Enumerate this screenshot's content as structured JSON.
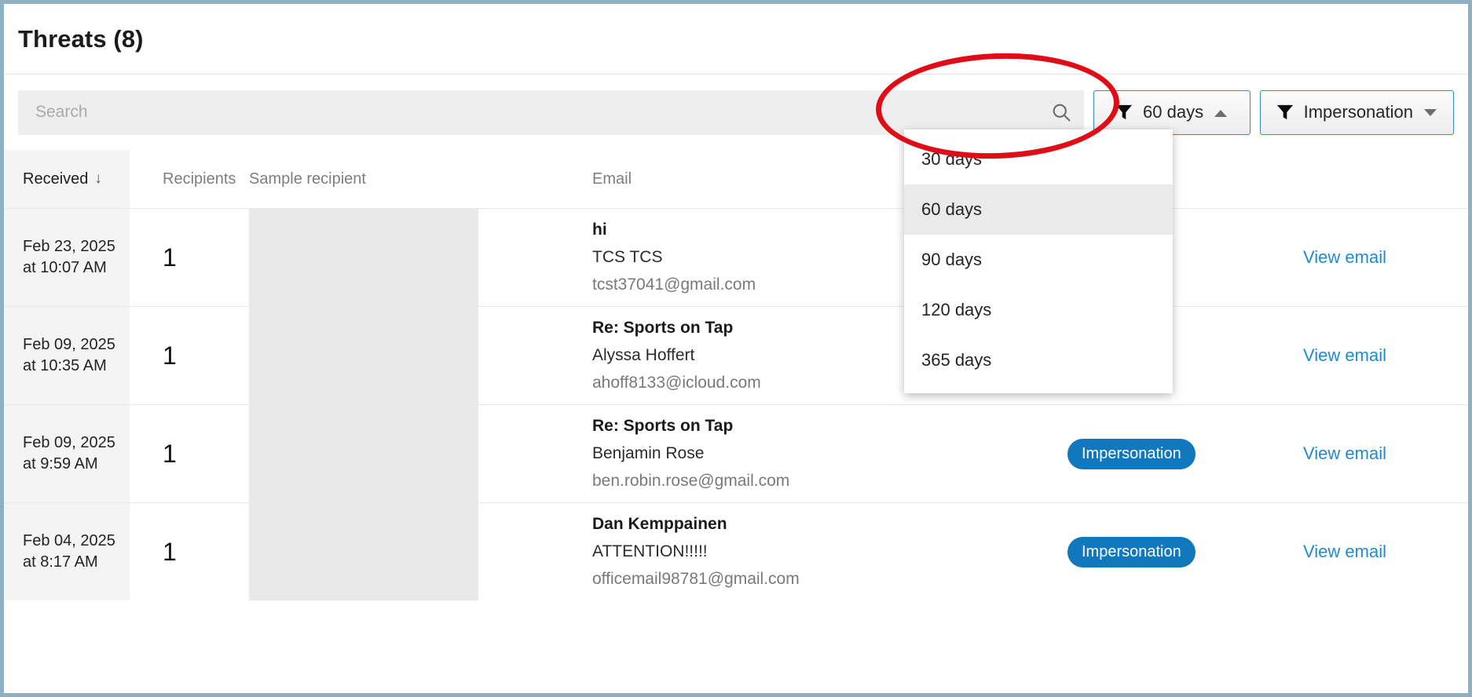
{
  "header": {
    "title": "Threats (8)"
  },
  "search": {
    "placeholder": "Search",
    "value": "",
    "icon": "search-icon"
  },
  "filters": {
    "date_range": {
      "label": "60 days",
      "icon": "funnel-icon",
      "caret": "chevron-up-icon",
      "expanded": true,
      "options": [
        "30 days",
        "60 days",
        "90 days",
        "120 days",
        "365 days"
      ],
      "selected": "60 days"
    },
    "threat_type": {
      "label": "Impersonation",
      "icon": "funnel-icon",
      "caret": "chevron-down-icon",
      "expanded": false
    }
  },
  "table": {
    "columns": {
      "received": "Received",
      "sort_indicator": "↓",
      "recipients": "Recipients",
      "sample_recipient": "Sample recipient",
      "email": "Email"
    },
    "rows": [
      {
        "received_date": "Feb 23, 2025",
        "received_time": "at 10:07 AM",
        "recipients": "1",
        "sample_recipient": "",
        "subject": "hi",
        "sender": "TCS TCS",
        "address": "tcst37041@gmail.com",
        "badge": "",
        "action": "View email"
      },
      {
        "received_date": "Feb 09, 2025",
        "received_time": "at 10:35 AM",
        "recipients": "1",
        "sample_recipient": "",
        "subject": "Re: Sports on Tap",
        "sender": "Alyssa Hoffert",
        "address": "ahoff8133@icloud.com",
        "badge": "",
        "action": "View email"
      },
      {
        "received_date": "Feb 09, 2025",
        "received_time": "at 9:59 AM",
        "recipients": "1",
        "sample_recipient": "",
        "subject": "Re: Sports on Tap",
        "sender": "Benjamin Rose",
        "address": "ben.robin.rose@gmail.com",
        "badge": "Impersonation",
        "action": "View email"
      },
      {
        "received_date": "Feb 04, 2025",
        "received_time": "at 8:17 AM",
        "recipients": "1",
        "sample_recipient": "",
        "subject": "Dan Kemppainen",
        "sender": "ATTENTION!!!!!",
        "address": "officemail98781@gmail.com",
        "badge": "Impersonation",
        "action": "View email"
      }
    ]
  },
  "colors": {
    "accent_link": "#1e8bd1",
    "badge_bg": "#1278be",
    "annotation": "#e00d16",
    "panel_border": "#8fb0c1",
    "focus_border": "#3a88c8"
  }
}
